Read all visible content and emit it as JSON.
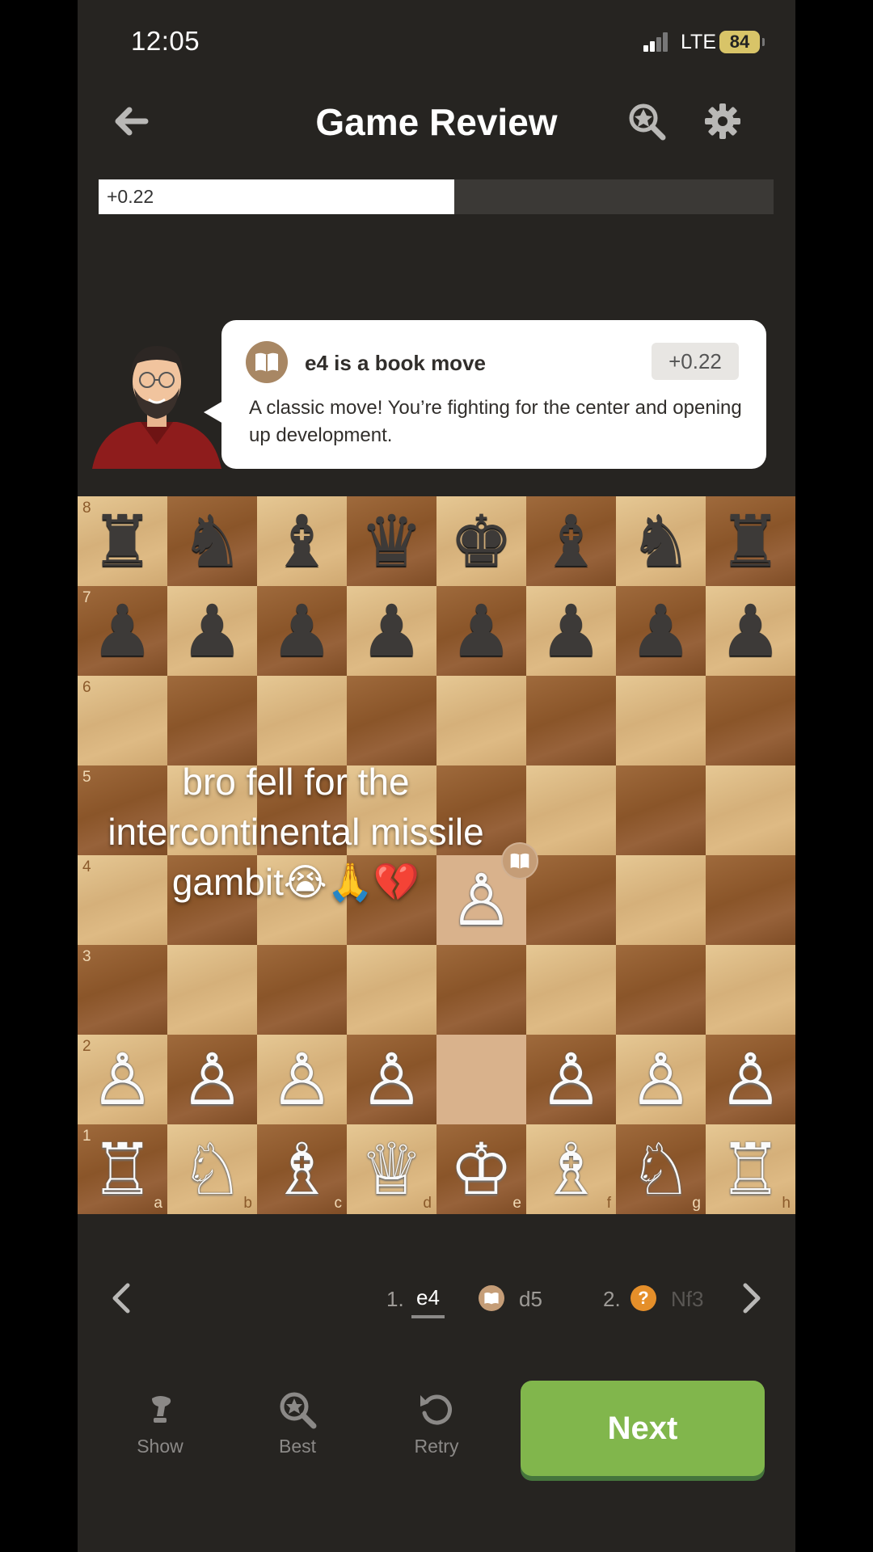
{
  "status_bar": {
    "time": "12:05",
    "network": "LTE",
    "battery": "84"
  },
  "header": {
    "title": "Game Review"
  },
  "eval_bar": {
    "score": "+0.22",
    "white_fraction": 0.527
  },
  "coach": {
    "headline": "e4 is a book move",
    "eval": "+0.22",
    "message": "A classic move! You’re fighting for the center and opening up development."
  },
  "board": {
    "ranks": [
      "8",
      "7",
      "6",
      "5",
      "4",
      "3",
      "2",
      "1"
    ],
    "files": [
      "a",
      "b",
      "c",
      "d",
      "e",
      "f",
      "g",
      "h"
    ],
    "position": [
      [
        "♜",
        "♞",
        "♝",
        "♛",
        "♚",
        "♝",
        "♞",
        "♜"
      ],
      [
        "♟",
        "♟",
        "♟",
        "♟",
        "♟",
        "♟",
        "♟",
        "♟"
      ],
      [
        "",
        "",
        "",
        "",
        "",
        "",
        "",
        ""
      ],
      [
        "",
        "",
        "",
        "",
        "",
        "",
        "",
        ""
      ],
      [
        "",
        "",
        "",
        "",
        "♙",
        "",
        "",
        ""
      ],
      [
        "",
        "",
        "",
        "",
        "",
        "",
        "",
        ""
      ],
      [
        "♙",
        "♙",
        "♙",
        "♙",
        "",
        "♙",
        "♙",
        "♙"
      ],
      [
        "♖",
        "♘",
        "♗",
        "♕",
        "♔",
        "♗",
        "♘",
        "♖"
      ]
    ],
    "piece_colors": [
      "b",
      "b",
      "",
      "",
      "w",
      "",
      "w",
      "w"
    ]
  },
  "overlay_caption": "bro fell for the intercontinental missile gambit😭🙏💔",
  "moves": {
    "num1": "1.",
    "m1": "e4",
    "m2": "d5",
    "num2": "2.",
    "m3_icon": "?",
    "m3": "Nf3"
  },
  "toolbar": {
    "show": "Show",
    "best": "Best",
    "retry": "Retry",
    "next": "Next"
  },
  "colors": {
    "next_button": "#81b64c",
    "book": "#a88764",
    "inaccuracy": "#e58f2a"
  },
  "icons": [
    "back-arrow-icon",
    "analysis-magnifier-icon",
    "gear-icon",
    "book-icon",
    "chevron-left-icon",
    "chevron-right-icon",
    "hint-icon",
    "best-magnifier-icon",
    "retry-icon"
  ]
}
